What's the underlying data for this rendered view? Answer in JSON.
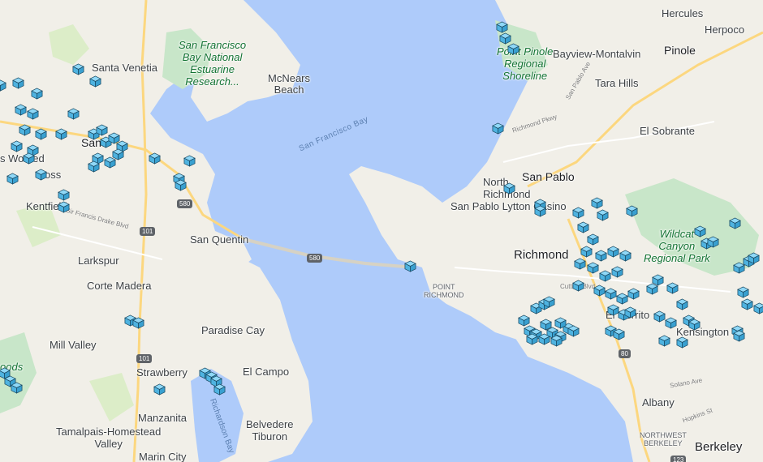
{
  "map": {
    "labels": {
      "hercules": "Hercules",
      "herpoco": "Herpoco",
      "pinole": "Pinole",
      "bayview": "Bayview-Montalvin",
      "tara_hills": "Tara Hills",
      "el_sobrante": "El Sobrante",
      "san_pablo": "San Pablo",
      "north_richmond": "North\nRichmond",
      "san_pablo_lytton": "San Pablo Lytton Casino",
      "richmond": "Richmond",
      "point_richmond": "POINT\nRICHMOND",
      "kensington": "Kensington",
      "albany": "Albany",
      "berkeley": "Berkeley",
      "nw_berkeley": "NORTHWEST\nBERKELEY",
      "el_cerrito": "El Cerrito",
      "santa_venetia": "Santa Venetia",
      "mcnears_beach": "McNears\nBeach",
      "san_rafael": "San Rafael",
      "kentfield": "Kentfield",
      "san_quentin": "San Quentin",
      "larkspur": "Larkspur",
      "corte_madera": "Corte Madera",
      "mill_valley": "Mill Valley",
      "paradise_cay": "Paradise Cay",
      "strawberry": "Strawberry",
      "el_campo": "El Campo",
      "belvedere_tiburon": "Belvedere\nTiburon",
      "manzanita": "Manzanita",
      "tamalpais": "Tamalpais-Homestead\nValley",
      "marin_city": "Marin City",
      "ross": "oss",
      "woodacre_partial": "s Wo    hed",
      "san_rafael_partial": "San"
    },
    "parks": {
      "sf_bay_reserve": "San Francisco\nBay National\nEstuarine\nResearch...",
      "point_pinole": "Point Pinole\nRegional\nShoreline",
      "wildcat": "Wildcat\nCanyon\nRegional Park",
      "woods_partial": "oods"
    },
    "water": {
      "san_francisco_bay": "San Francisco Bay",
      "richardson_bay": "Richardson Bay"
    },
    "roads": {
      "hwy_580_a": "580",
      "hwy_580_b": "580",
      "hwy_101_a": "101",
      "hwy_101_b": "101",
      "hwy_80": "80",
      "hwy_123": "123",
      "sir_francis_drake": "Sir Francis Drake Blvd",
      "richmond_pkwy": "Richmond Pkwy",
      "cutting_blvd": "Cutting Blvd",
      "san_pablo_ave": "San Pablo Ave",
      "solano_ave": "Solano Ave",
      "hopkins_st": "Hopkins St"
    },
    "colors": {
      "water": "#aecbfa",
      "land": "#f1efe8",
      "park": "#c8e6c9",
      "highway": "#fcd77f",
      "marker": "#5bc0eb"
    },
    "marker_icon": "cube-marker-icon"
  }
}
